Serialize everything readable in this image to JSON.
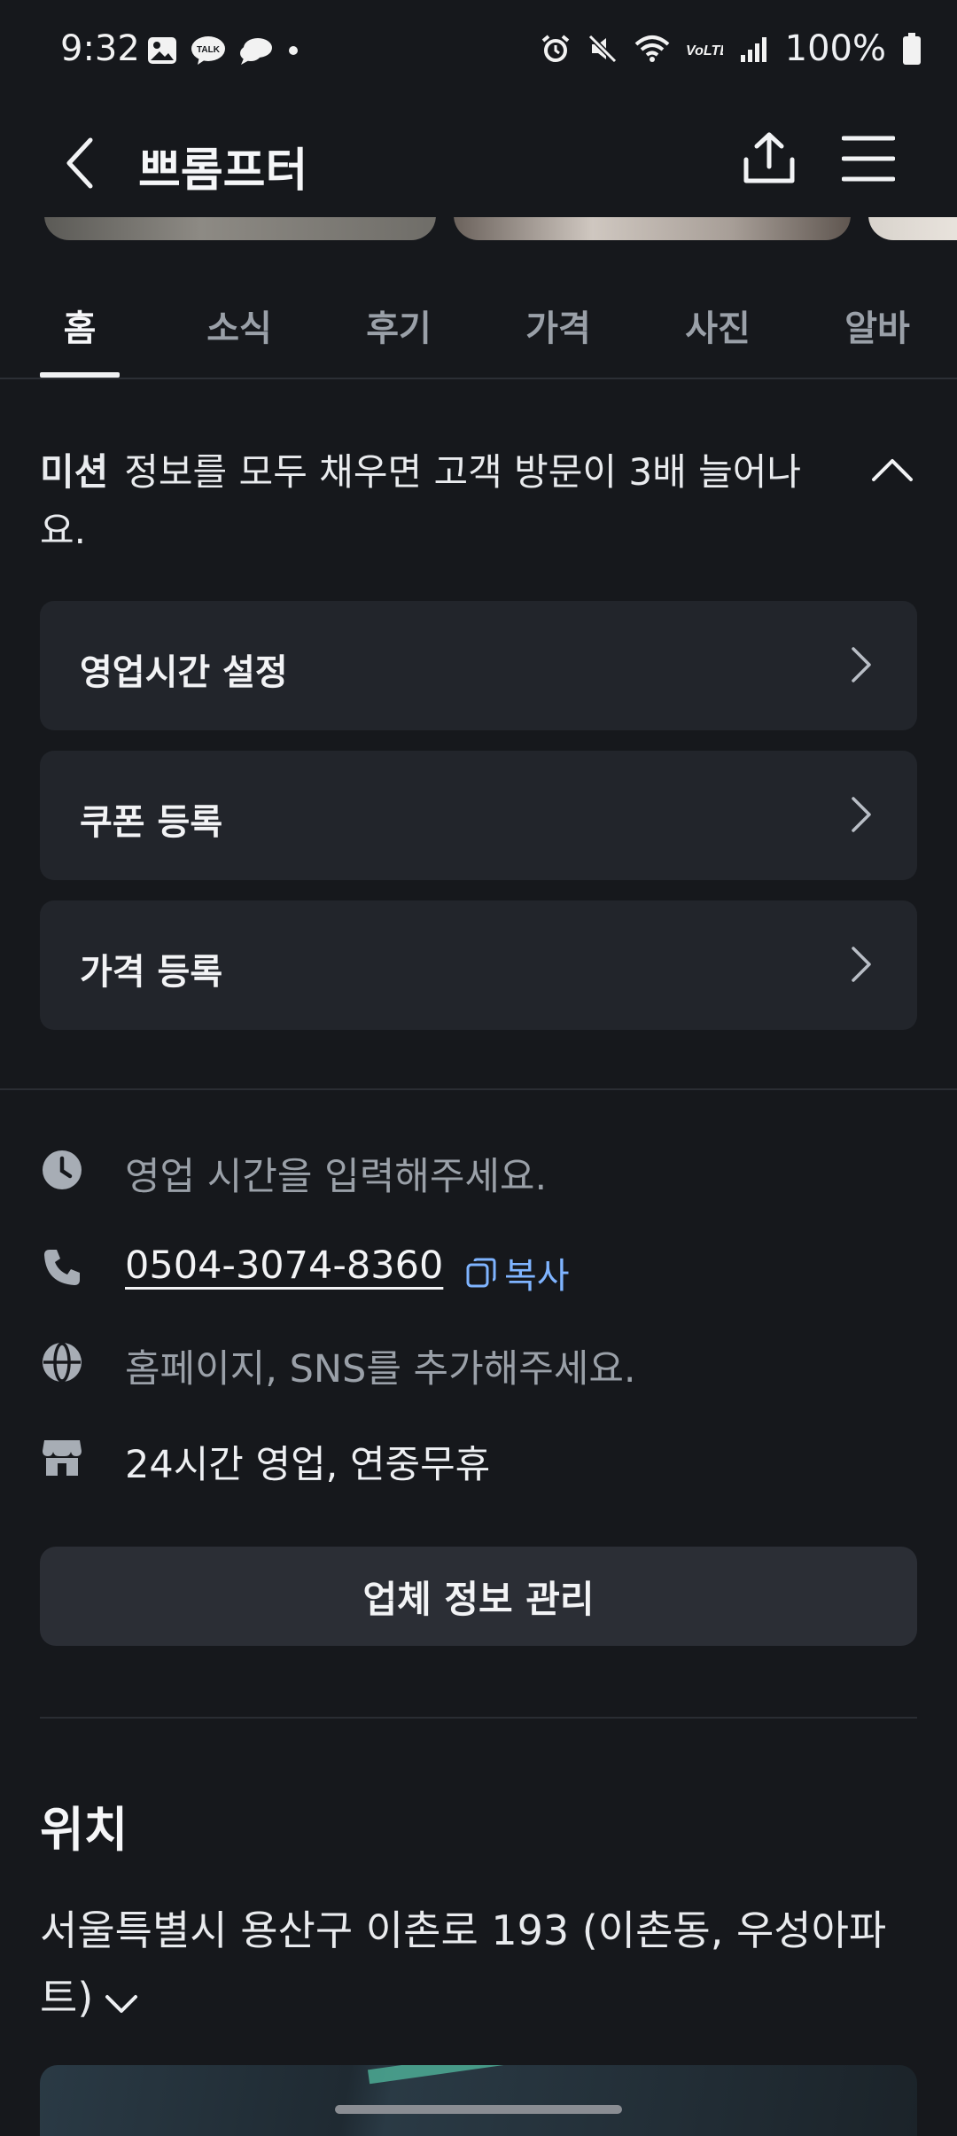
{
  "status_bar": {
    "time": "9:32",
    "battery": "100%",
    "icons": [
      "gallery-icon",
      "talk-icon",
      "chat-icon",
      "dot-icon",
      "alarm-icon",
      "mute-icon",
      "wifi-icon",
      "volte-icon",
      "signal-icon",
      "battery-icon"
    ]
  },
  "app_bar": {
    "title": "쁘롬프터"
  },
  "tabs": [
    {
      "label": "홈",
      "active": true
    },
    {
      "label": "소식"
    },
    {
      "label": "후기"
    },
    {
      "label": "가격"
    },
    {
      "label": "사진"
    },
    {
      "label": "알바"
    }
  ],
  "mission": {
    "label": "미션",
    "text": "정보를 모두 채우면 고객 방문이 3배 늘어나요."
  },
  "tasks": [
    {
      "label": "영업시간 설정"
    },
    {
      "label": "쿠폰 등록"
    },
    {
      "label": "가격 등록"
    }
  ],
  "info": {
    "hours_placeholder": "영업 시간을 입력해주세요.",
    "phone": "0504-3074-8360",
    "copy_label": "복사",
    "homepage_placeholder": "홈페이지, SNS를 추가해주세요.",
    "business_status": "24시간 영업, 연중무휴"
  },
  "manage_button": "업체 정보 관리",
  "location": {
    "title": "위치",
    "address": "서울특별시 용산구 이촌로 193 (이촌동, 우성아파트)"
  },
  "colors": {
    "background": "#16181c",
    "card": "#22252b",
    "accent_link": "#7fb4ff"
  }
}
